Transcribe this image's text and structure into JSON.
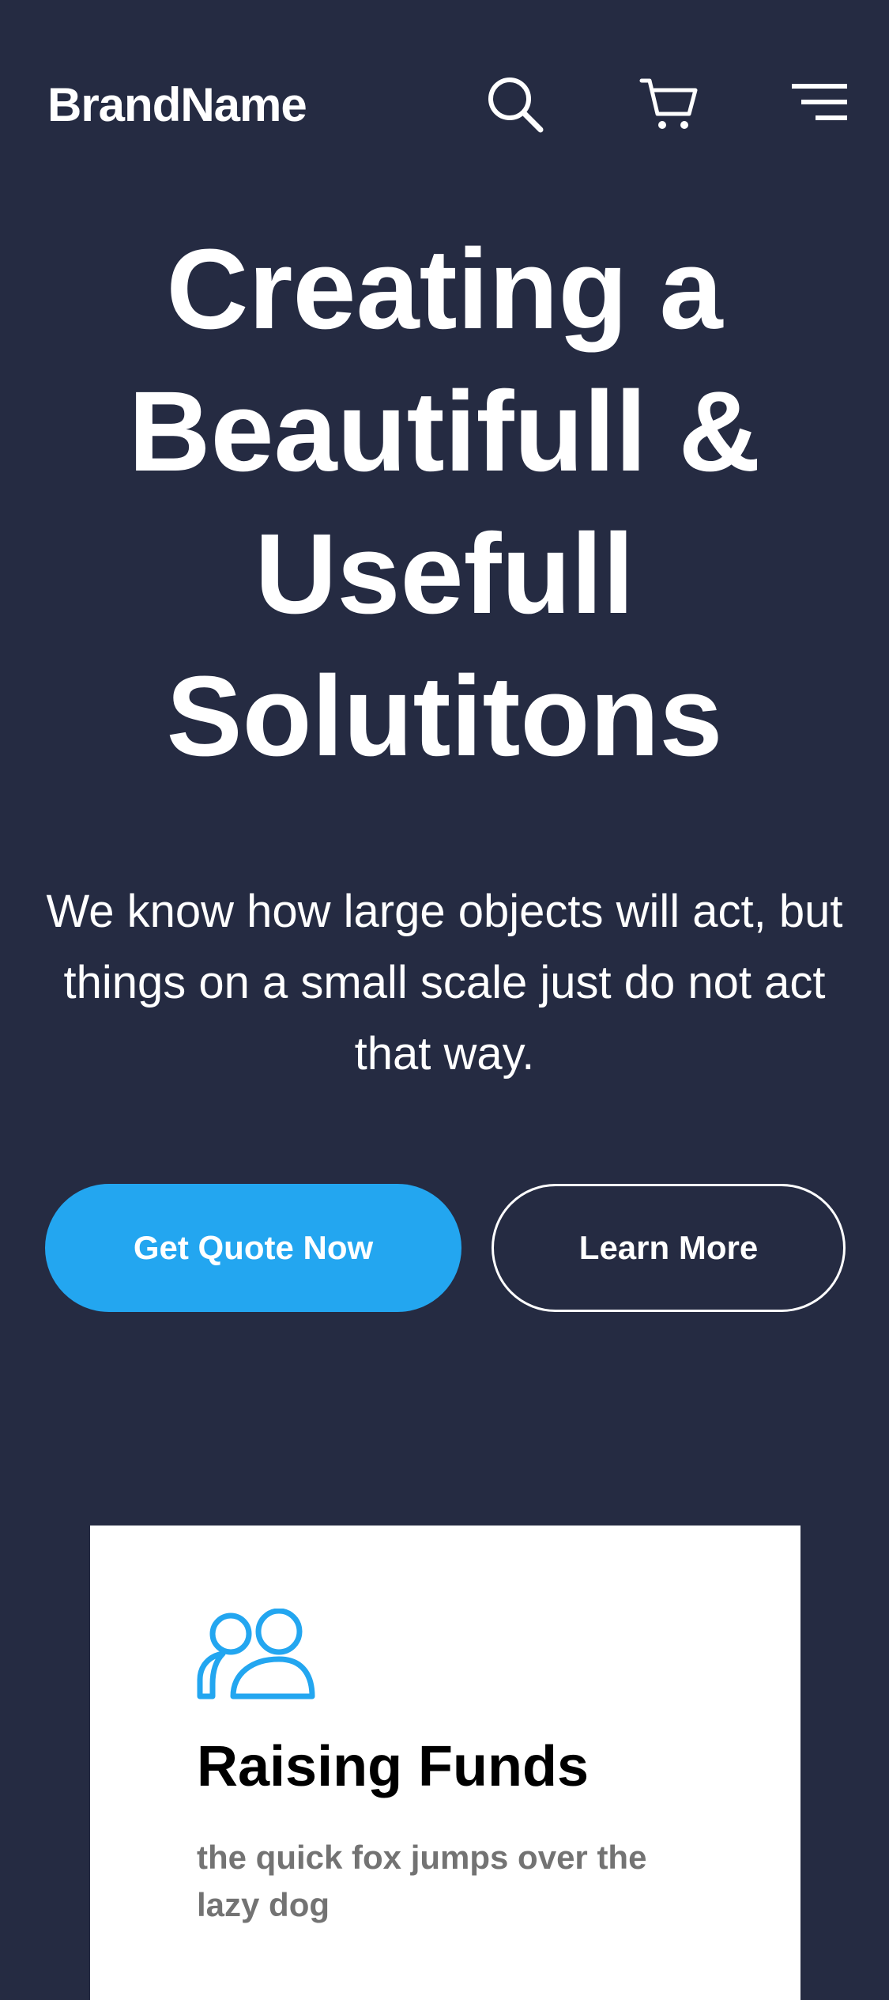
{
  "header": {
    "brand": "BrandName",
    "icons": [
      "search-icon",
      "cart-icon",
      "menu-icon"
    ]
  },
  "hero": {
    "title_lines": [
      "Creating a",
      "Beautifull &",
      "Usefull",
      "Solutitons"
    ],
    "subtitle": "We know how large objects will act, but things on a small scale just do not act that way.",
    "primary_button": "Get Quote Now",
    "secondary_button": "Learn More"
  },
  "feature_card": {
    "icon": "users-icon",
    "title": "Raising Funds",
    "text": "the quick fox jumps over the lazy dog"
  },
  "colors": {
    "background": "#252B42",
    "accent": "#23A6F0",
    "card_background": "#FFFFFF",
    "card_title": "#000000",
    "card_text": "#737373"
  }
}
